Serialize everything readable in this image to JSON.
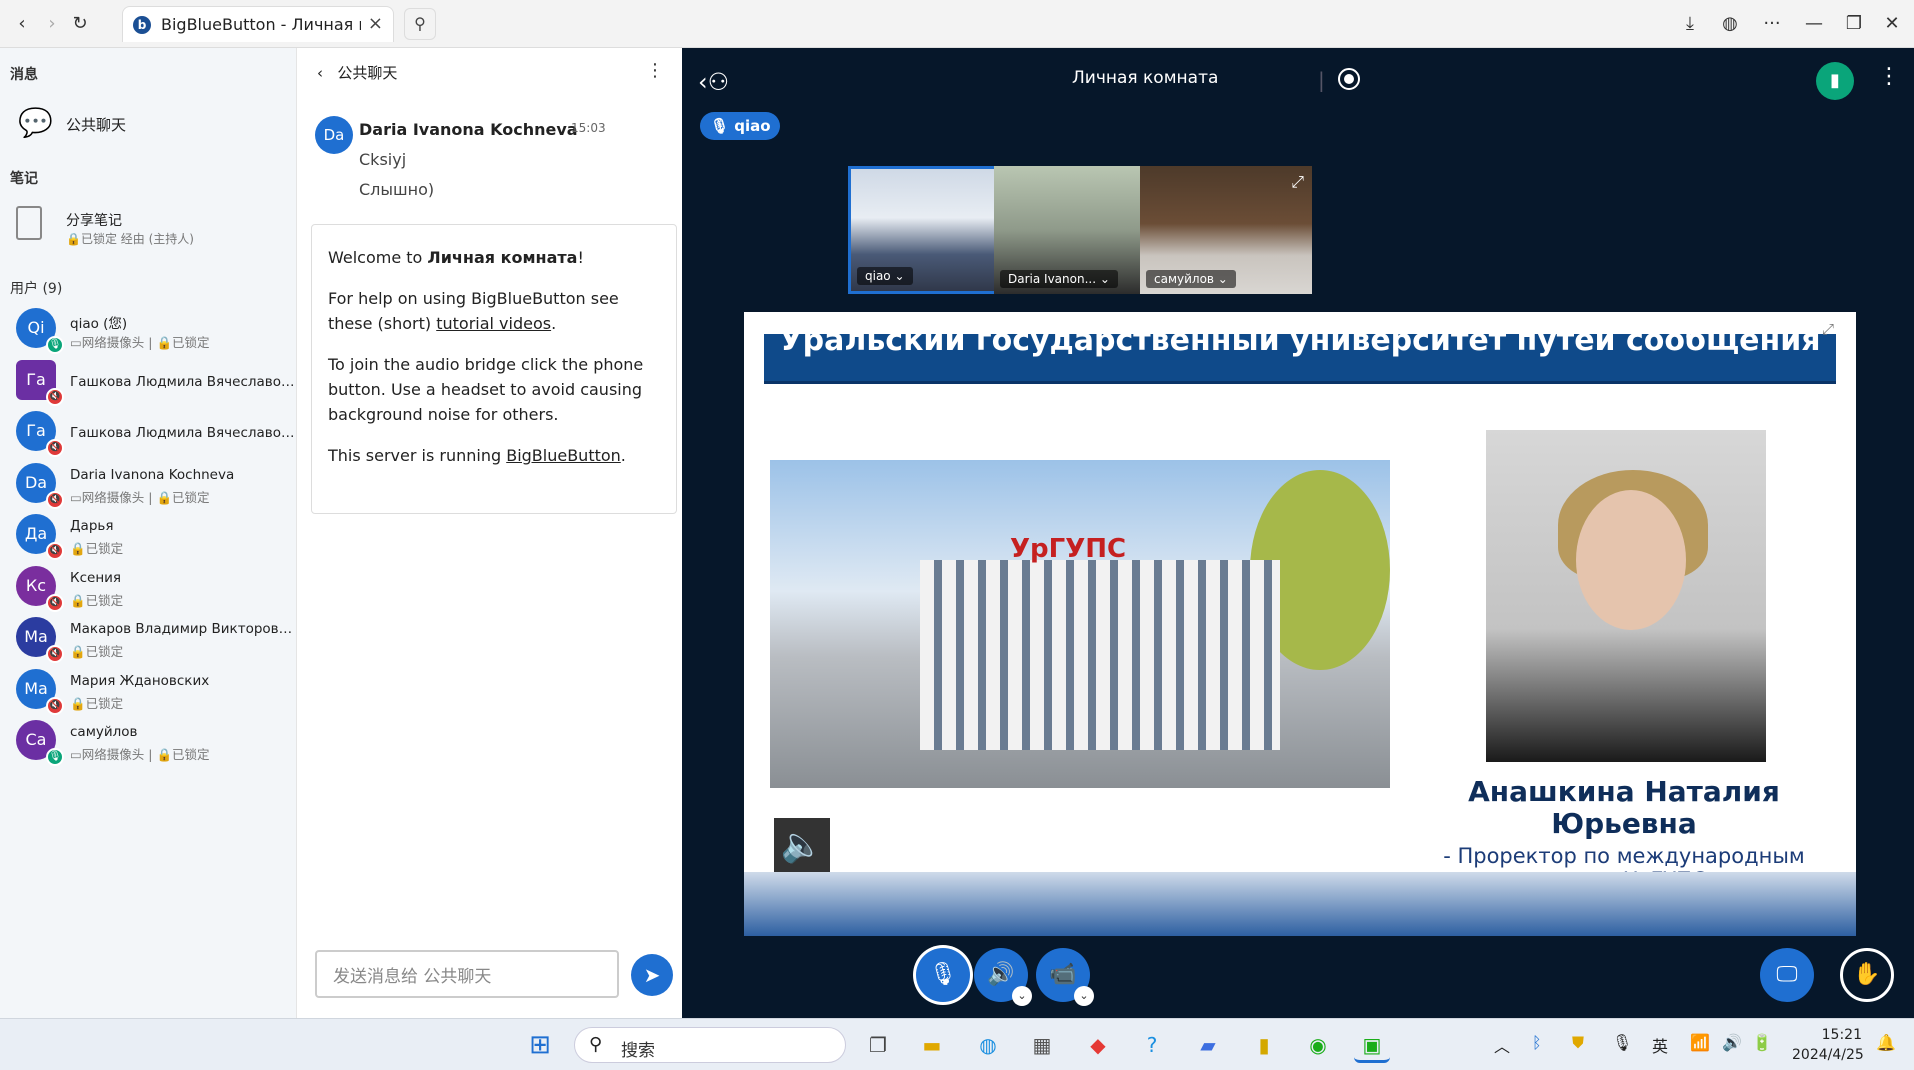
{
  "browser": {
    "tab_title": "BigBlueButton - Личная комната",
    "favicon_letter": "b",
    "back_icon": "‹",
    "forward_icon": "›",
    "reload_icon": "↻",
    "close_tab": "×",
    "search_icon": "⚲",
    "download_icon": "⤓",
    "globe_icon": "◍",
    "more_icon": "···",
    "min_icon": "—",
    "restore_icon": "❐",
    "close_icon": "✕"
  },
  "sidebar": {
    "messages_header": "消息",
    "public_chat": "公共聊天",
    "notes_header": "笔记",
    "shared_notes": "分享笔记",
    "shared_notes_status": "🔒已锁定 经由 (主持人)",
    "users_header": "用户 (9)",
    "users": [
      {
        "initials": "Qi",
        "name": "qiao (您)",
        "status": "▭网络摄像头 | 🔒已锁定",
        "color": "#1f6fd1",
        "badge": "🎙",
        "badge_color": "#0aa57a"
      },
      {
        "initials": "Га",
        "name": "Гашкова Людмила Вячеславовна",
        "status": "",
        "color": "#6b2fa3",
        "badge": "🔇",
        "badge_color": "#e03a3a"
      },
      {
        "initials": "Га",
        "name": "Гашкова Людмила Вячеславовна",
        "status": "",
        "color": "#1f6fd1",
        "badge": "🔇",
        "badge_color": "#e03a3a"
      },
      {
        "initials": "Da",
        "name": "Daria Ivanona Kochneva",
        "status": "▭网络摄像头 | 🔒已锁定",
        "color": "#1f6fd1",
        "badge": "🔇",
        "badge_color": "#e03a3a"
      },
      {
        "initials": "Да",
        "name": "Дарья",
        "status": "🔒已锁定",
        "color": "#1f6fd1",
        "badge": "🔇",
        "badge_color": "#e03a3a"
      },
      {
        "initials": "Кс",
        "name": "Ксения",
        "status": "🔒已锁定",
        "color": "#7a2e9e",
        "badge": "🔇",
        "badge_color": "#e03a3a"
      },
      {
        "initials": "Ма",
        "name": "Макаров Владимир Викторович...",
        "status": "🔒已锁定",
        "color": "#2b3ca0",
        "badge": "🔇",
        "badge_color": "#e03a3a"
      },
      {
        "initials": "Ма",
        "name": "Мария Ждановских",
        "status": "🔒已锁定",
        "color": "#1f6fd1",
        "badge": "🔇",
        "badge_color": "#e03a3a"
      },
      {
        "initials": "Са",
        "name": "самуйлов",
        "status": "▭网络摄像头 | 🔒已锁定",
        "color": "#6b2fa3",
        "badge": "🎙",
        "badge_color": "#0aa57a"
      }
    ]
  },
  "chat": {
    "title": "公共聊天",
    "back": "‹",
    "menu": "⋮",
    "message": {
      "initials": "Da",
      "sender": "Daria Ivanona Kochneva",
      "time": "15:03",
      "lines": [
        "Cksiyj",
        "Слышно)"
      ]
    },
    "welcome": {
      "p1_pre": "Welcome to ",
      "p1_bold": "Личная комната",
      "p1_post": "!",
      "p2_pre": "For help on using BigBlueButton see these (short) ",
      "p2_link": "tutorial videos",
      "p2_post": ".",
      "p3": "To join the audio bridge click the phone button. Use a headset to avoid causing background noise for others.",
      "p4_pre": "This server is running ",
      "p4_link": "BigBlueButton",
      "p4_post": "."
    },
    "input_placeholder": "发送消息给 公共聊天",
    "send_icon": "➤"
  },
  "main": {
    "room_title": "Личная комната",
    "talking": "qiao",
    "talk_icon": "🎙",
    "user_list_icon": "‹⚇",
    "conn_icon": "▮",
    "menu_icon": "⋮",
    "tiles": [
      {
        "name": "qiao ⌄",
        "bg": "linear-gradient(180deg,#cfd9e6 0%,#e8edf3 40%,#4a5a77 70%,#30384a 100%)"
      },
      {
        "name": "Daria Ivanon... ⌄",
        "bg": "linear-gradient(180deg,#b9c6b2 0%,#8f9a8a 50%,#2c2c2c 100%)"
      },
      {
        "name": "самуйлов ⌄",
        "bg": "linear-gradient(180deg,#4d3a2a 0%,#6b4d36 45%,#c9c4be 70%,#d9d6d2 100%)"
      }
    ],
    "fullscreen_icon": "⤢",
    "slide": {
      "title": "Уральский государственный университет путей сообщения",
      "sign": "УрГУПС",
      "person_name": "Анашкина Наталия Юрьевна",
      "person_role": "- Проректор по международным связям УрГУПС",
      "speaker_icon": "🔈"
    },
    "controls": {
      "mic": "🎙",
      "audio": "🔊",
      "camera": "📹",
      "dropdown": "⌄",
      "present": "🖵",
      "hand": "✋"
    }
  },
  "taskbar": {
    "search_text": "搜索",
    "search_icon": "⚲",
    "ime": "英",
    "time": "15:21",
    "date": "2024/4/25",
    "tray_up": "︿",
    "tray_wifi": "📶",
    "tray_vol": "🔊",
    "tray_bat": "🔋",
    "tray_mic": "🎙",
    "notif": "🔔"
  }
}
